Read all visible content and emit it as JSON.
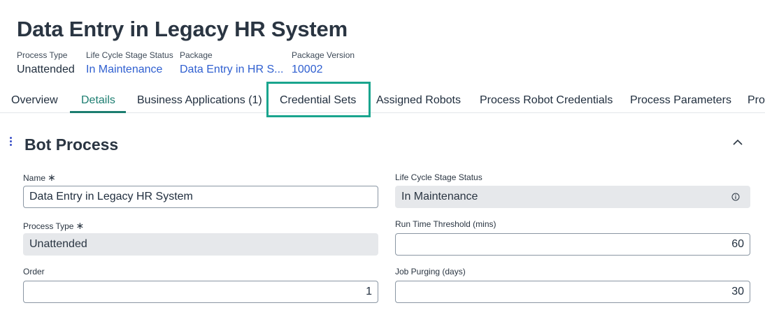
{
  "page": {
    "title": "Data Entry in Legacy HR System"
  },
  "meta": {
    "process_type": {
      "label": "Process Type",
      "value": "Unattended"
    },
    "lifecycle": {
      "label": "Life Cycle Stage Status",
      "value": "In Maintenance"
    },
    "package": {
      "label": "Package",
      "value": "Data Entry in HR S..."
    },
    "package_version": {
      "label": "Package Version",
      "value": "10002"
    }
  },
  "tabs": [
    {
      "label": "Overview"
    },
    {
      "label": "Details",
      "active": true
    },
    {
      "label": "Business Applications (1)"
    },
    {
      "label": "Credential Sets",
      "highlighted": true
    },
    {
      "label": "Assigned Robots"
    },
    {
      "label": "Process Robot Credentials"
    },
    {
      "label": "Process Parameters"
    },
    {
      "label": "Pro"
    }
  ],
  "section": {
    "title": "Bot Process"
  },
  "form": {
    "name": {
      "label": "Name",
      "required_mark": "∗",
      "value": "Data Entry in Legacy HR System"
    },
    "process_type": {
      "label": "Process Type",
      "required_mark": "∗",
      "value": "Unattended"
    },
    "order": {
      "label": "Order",
      "value": "1"
    },
    "lifecycle": {
      "label": "Life Cycle Stage Status",
      "value": "In Maintenance"
    },
    "run_time": {
      "label": "Run Time Threshold (mins)",
      "value": "60"
    },
    "job_purging": {
      "label": "Job Purging (days)",
      "value": "30"
    }
  },
  "icons": {
    "kebab": "kebab-menu-icon",
    "collapse": "chevron-up-icon",
    "info": "info-icon"
  },
  "colors": {
    "accent": "#1c7d70",
    "highlight": "#1aa58e",
    "link": "#2f5fd0"
  }
}
